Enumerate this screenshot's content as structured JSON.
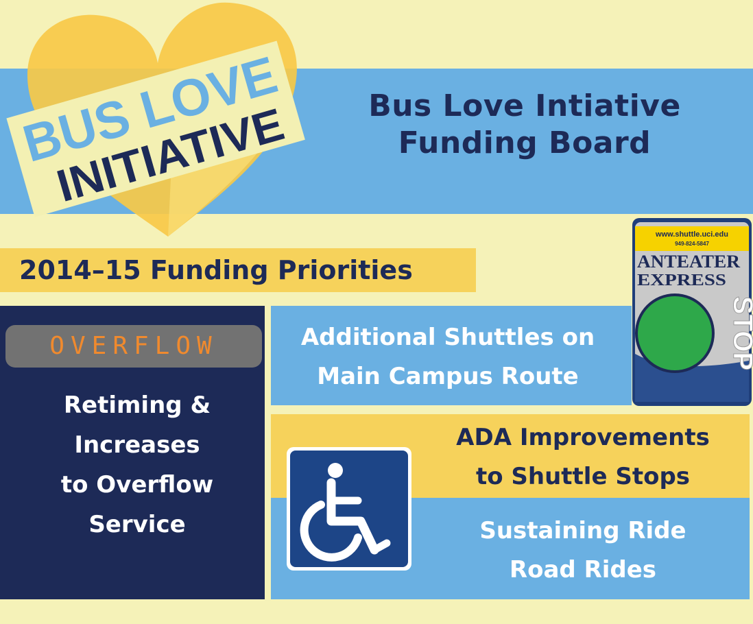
{
  "logo": {
    "line1": "BUS LOVE",
    "line2": "INITIATIVE",
    "icon": "heart-icon"
  },
  "header": {
    "title_line1": "Bus Love Intiative",
    "title_line2": "Funding Board"
  },
  "priorities": {
    "heading": "2014–15 Funding Priorities"
  },
  "overflow": {
    "badge": "OVERFLOW",
    "lines": [
      "Retiming &",
      "Increases",
      "to Overflow",
      "Service"
    ]
  },
  "shuttles": {
    "lines": [
      "Additional Shuttles on",
      "Main Campus Route"
    ]
  },
  "ada": {
    "lines": [
      "ADA Improvements",
      "to Shuttle Stops"
    ],
    "icon": "wheelchair-icon"
  },
  "ride": {
    "lines": [
      "Sustaining Ride",
      "Road Rides"
    ]
  },
  "stop_sign": {
    "url": "www.shuttle.uci.edu",
    "phone": "949-824-5847",
    "brand_line1": "ANTEATER",
    "brand_line2": "EXPRESS",
    "stop": "STOP"
  },
  "colors": {
    "navy": "#1d2a57",
    "blue": "#6ab0e2",
    "yellow": "#f6d25b",
    "cream": "#f5f2b8",
    "orange": "#f08a2e"
  }
}
